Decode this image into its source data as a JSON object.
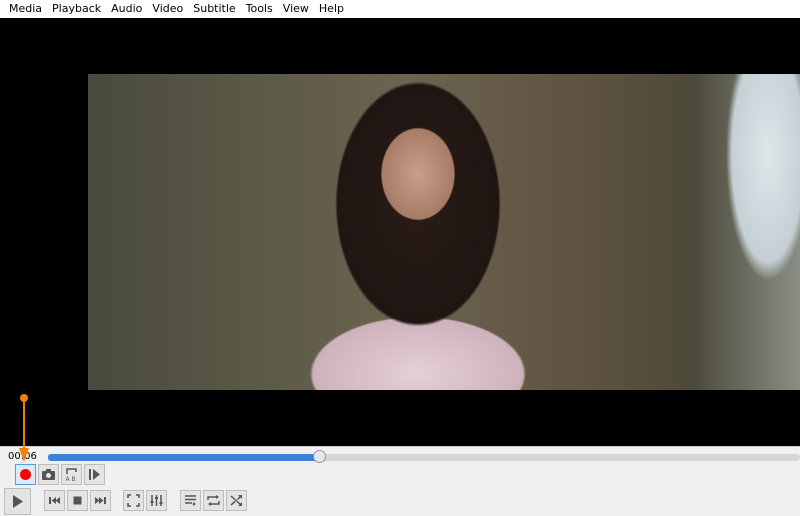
{
  "menu": [
    "Media",
    "Playback",
    "Audio",
    "Video",
    "Subtitle",
    "Tools",
    "View",
    "Help"
  ],
  "player": {
    "elapsed": "00:06",
    "progress_percent": 36
  },
  "controls": {
    "advanced": [
      "record-icon",
      "snapshot-icon",
      "ab-loop-icon",
      "frame-step-icon"
    ],
    "main": [
      "play-icon",
      "previous-icon",
      "stop-icon",
      "next-icon",
      "fullscreen-icon",
      "extended-settings-icon",
      "playlist-icon",
      "loop-icon",
      "shuffle-icon"
    ]
  },
  "colors": {
    "accent": "#3d80d6",
    "record": "#ff0000",
    "annotation": "#f08010"
  }
}
